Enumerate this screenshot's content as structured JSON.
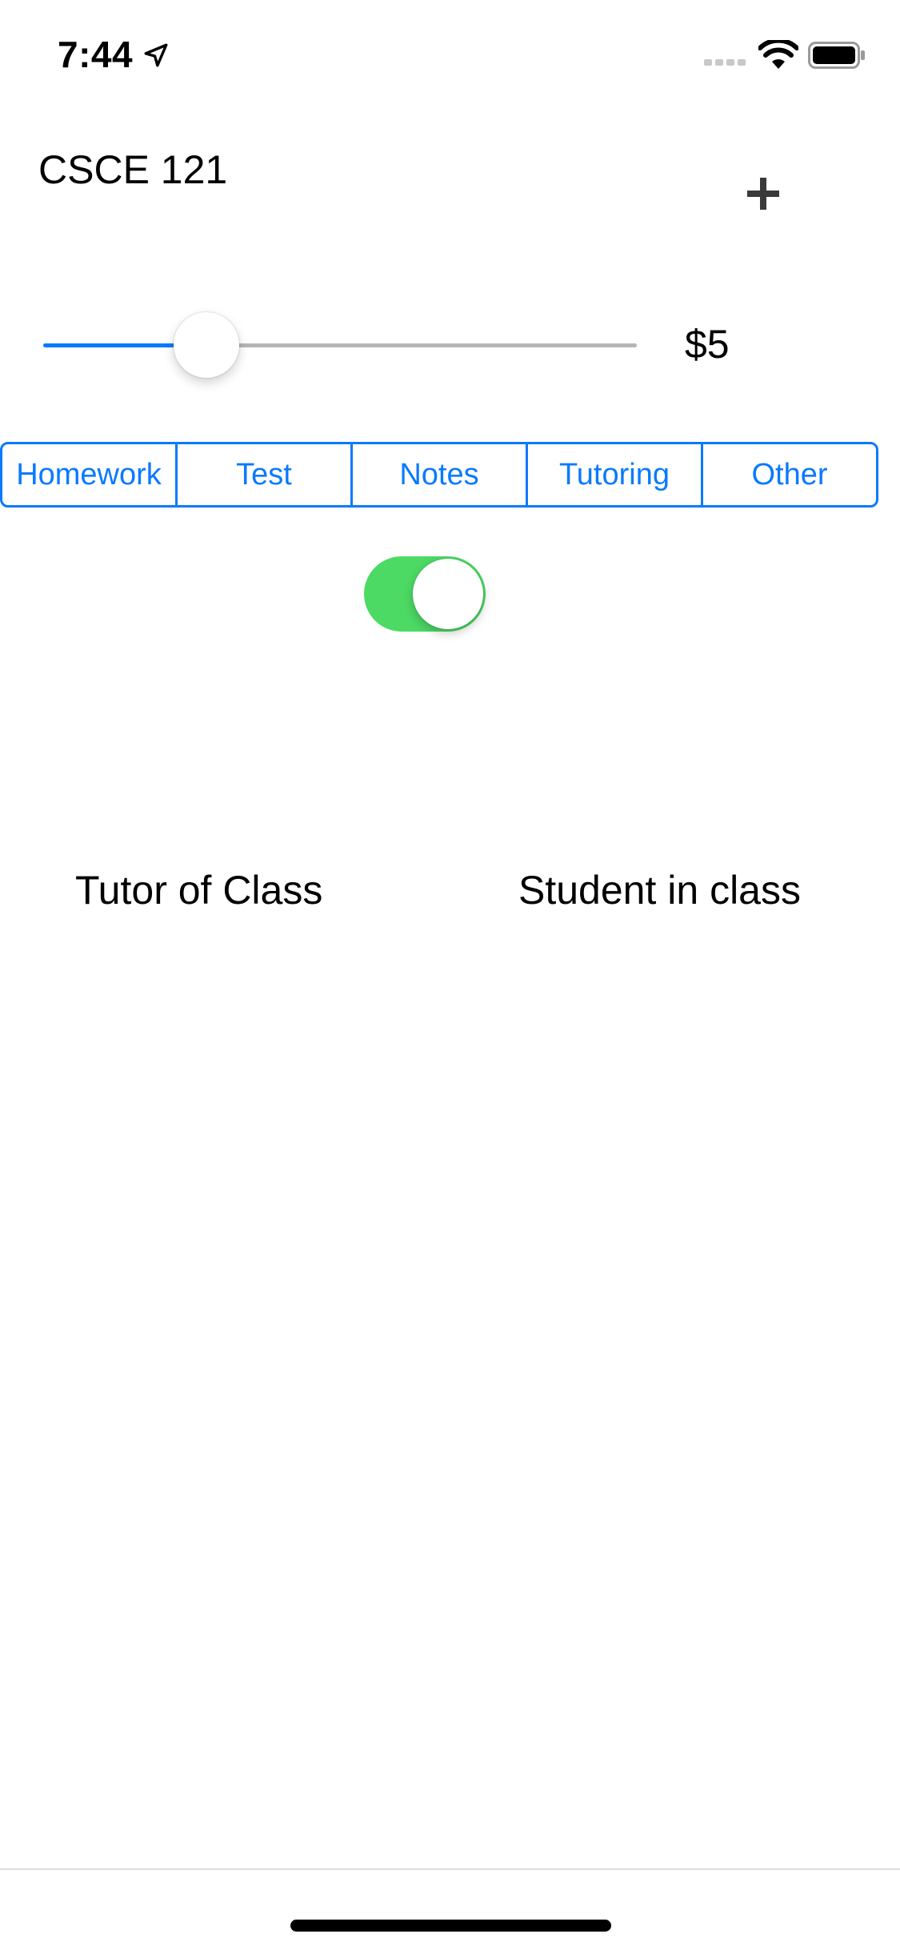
{
  "status_bar": {
    "time": "7:44",
    "icons": [
      "location-arrow-icon",
      "cellular-signal-icon",
      "wifi-icon",
      "battery-icon"
    ]
  },
  "header": {
    "title": "CSCE 121",
    "add_icon": "plus-icon"
  },
  "price_slider": {
    "level": 0.275,
    "value_label": "$5",
    "accent_color": "#0a7afe"
  },
  "category_segments": {
    "items": [
      {
        "label": "Homework"
      },
      {
        "label": "Test"
      },
      {
        "label": "Notes"
      },
      {
        "label": "Tutoring"
      },
      {
        "label": "Other"
      }
    ],
    "accent_color": "#0a7afe"
  },
  "role_toggle": {
    "on": true,
    "on_color": "#4cd964"
  },
  "role_labels": {
    "left": "Tutor of Class",
    "right": "Student in class"
  }
}
